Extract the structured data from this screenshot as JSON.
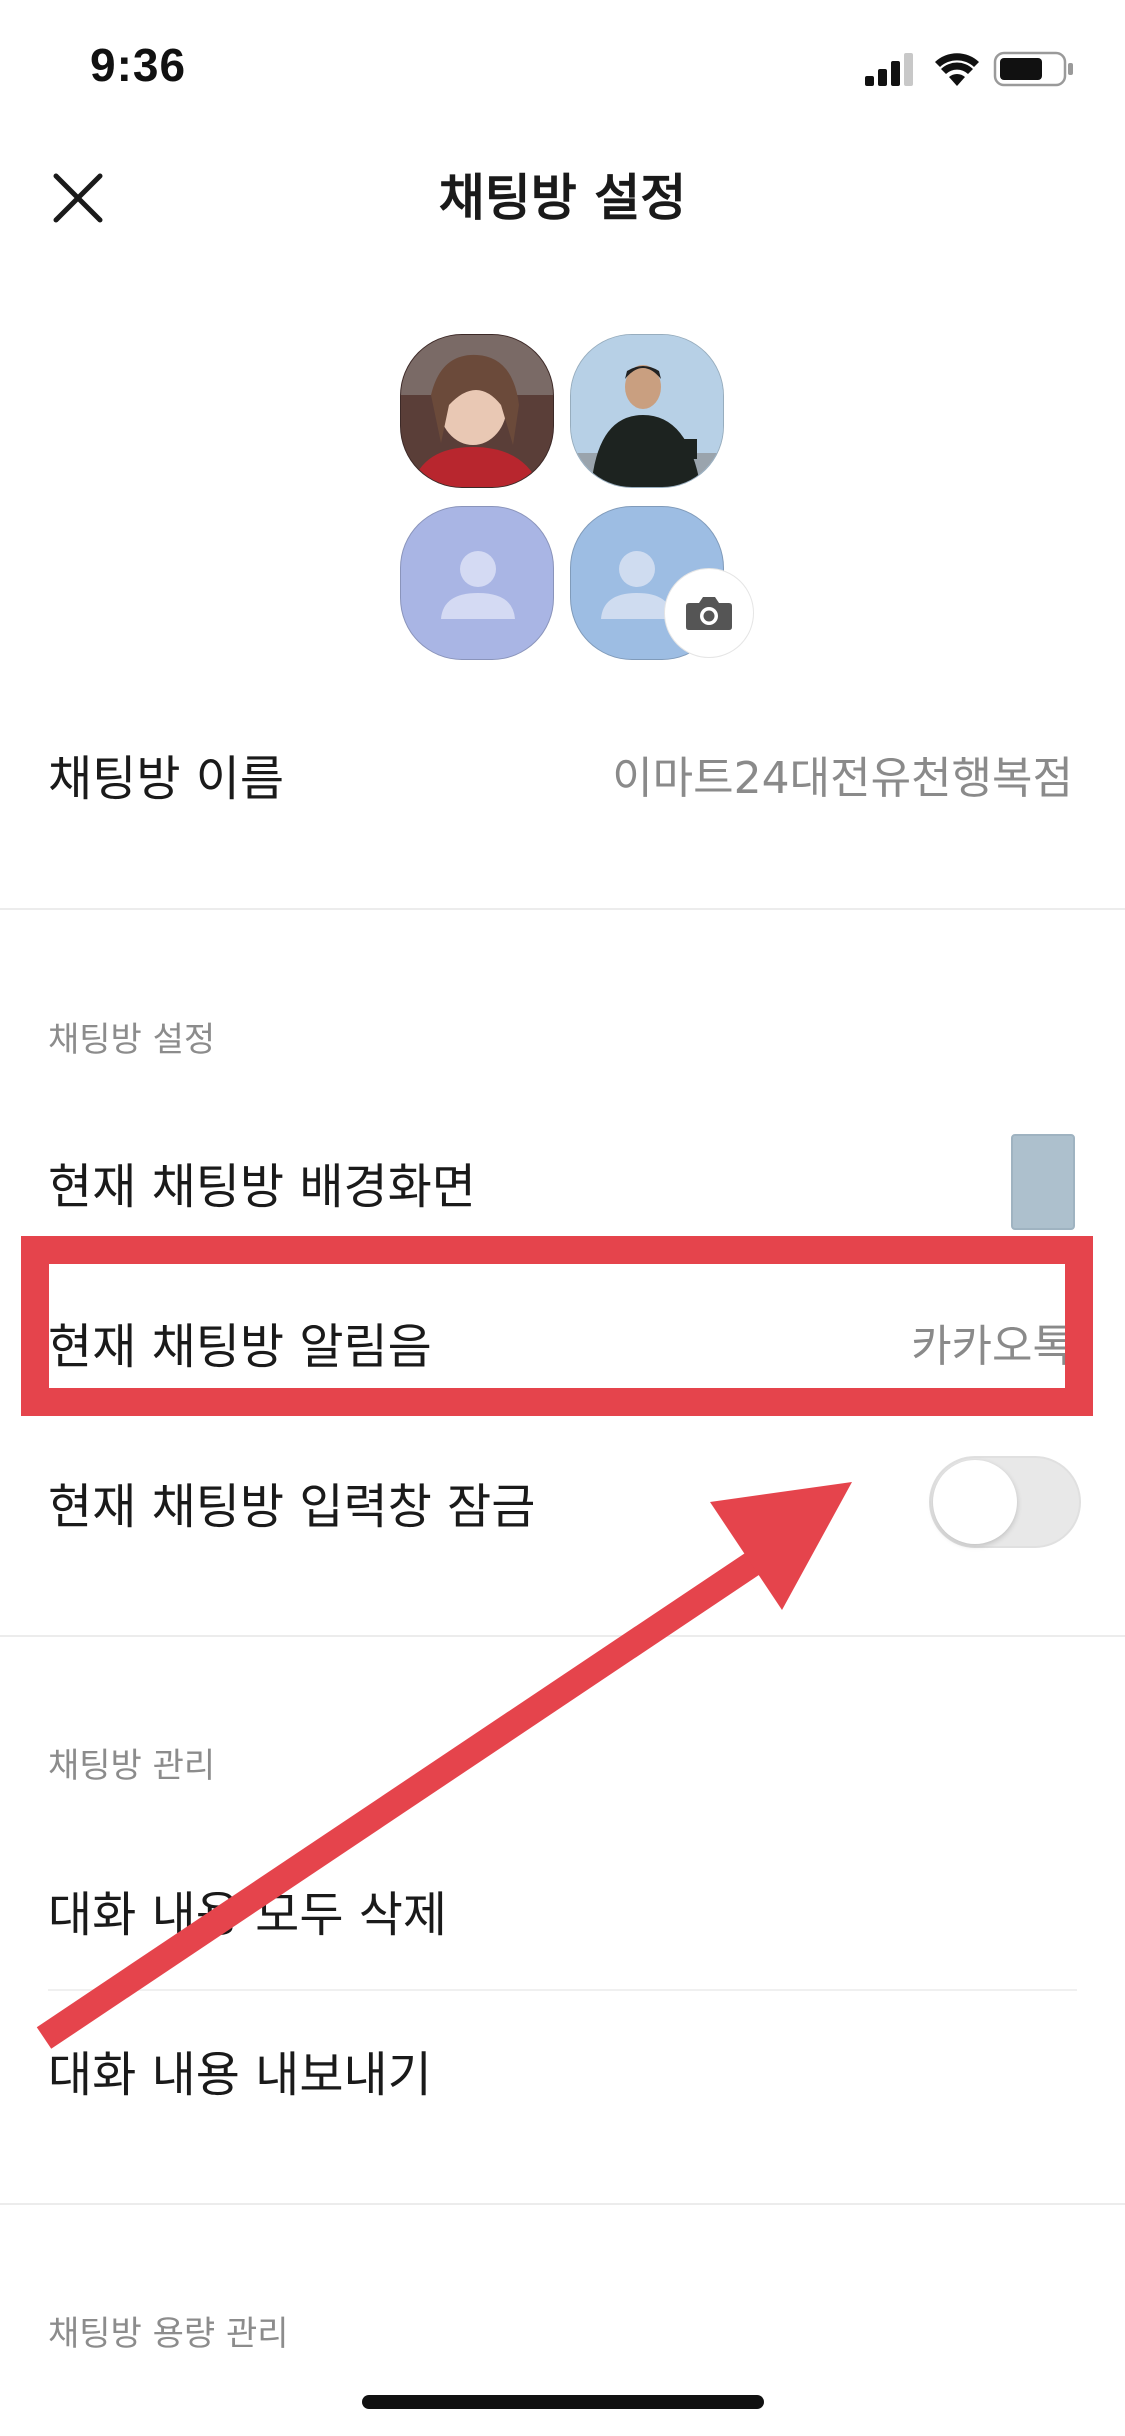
{
  "status_bar": {
    "time": "9:36"
  },
  "header": {
    "title": "채팅방 설정",
    "close_icon": "close-icon"
  },
  "avatars": {
    "camera_icon": "camera-icon",
    "placeholder_icon": "person-icon"
  },
  "room_name": {
    "label": "채팅방 이름",
    "value": "이마트24대전유천행복점"
  },
  "settings_section": {
    "header": "채팅방 설정",
    "wallpaper_label": "현재 채팅방 배경화면",
    "wallpaper_color": "#adc0cd",
    "notification_label": "현재 채팅방 알림음",
    "notification_value": "카카오톡",
    "input_lock_label": "현재 채팅방 입력창 잠금",
    "input_lock_on": false
  },
  "manage_section": {
    "header": "채팅방 관리",
    "delete_all_label": "대화 내용 모두 삭제",
    "export_label": "대화 내용 내보내기"
  },
  "storage_section": {
    "header": "채팅방 용량 관리"
  },
  "annotation": {
    "highlight_color": "#e5444c"
  }
}
